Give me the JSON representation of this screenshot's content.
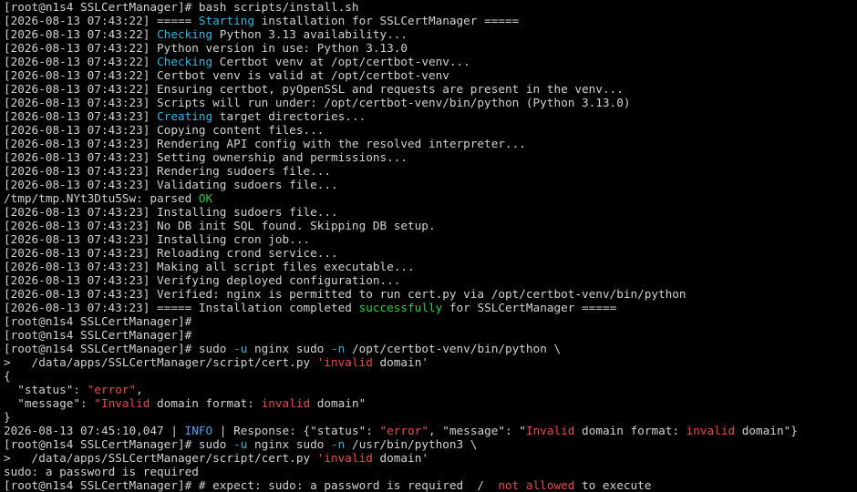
{
  "terminal": {
    "prompt": "[root@n1s4 SSLCertManager]#",
    "colors": {
      "background": "#000000",
      "default": "#d2d2d2",
      "cyan": "#29b8e6",
      "green": "#2ecc40",
      "red": "#ef4646",
      "blue": "#4aa0ee"
    },
    "lines": [
      [
        {
          "t": "[root@n1s4 SSLCertManager]# bash scripts/install.sh",
          "c": "default"
        }
      ],
      [
        {
          "t": "[2026-08-13 07:43:22] ===== ",
          "c": "default"
        },
        {
          "t": "Starting",
          "c": "cyan"
        },
        {
          "t": " installation for SSLCertManager =====",
          "c": "default"
        }
      ],
      [
        {
          "t": "[2026-08-13 07:43:22] ",
          "c": "default"
        },
        {
          "t": "Checking",
          "c": "cyan"
        },
        {
          "t": " Python 3.13 availability...",
          "c": "default"
        }
      ],
      [
        {
          "t": "[2026-08-13 07:43:22] Python version in use: Python 3.13.0",
          "c": "default"
        }
      ],
      [
        {
          "t": "[2026-08-13 07:43:22] ",
          "c": "default"
        },
        {
          "t": "Checking",
          "c": "cyan"
        },
        {
          "t": " Certbot venv at /opt/certbot-venv...",
          "c": "default"
        }
      ],
      [
        {
          "t": "[2026-08-13 07:43:22] Certbot venv is valid at /opt/certbot-venv",
          "c": "default"
        }
      ],
      [
        {
          "t": "[2026-08-13 07:43:22] Ensuring certbot, pyOpenSSL and requests are present in the venv...",
          "c": "default"
        }
      ],
      [
        {
          "t": "[2026-08-13 07:43:23] Scripts will run under: /opt/certbot-venv/bin/python (Python 3.13.0)",
          "c": "default"
        }
      ],
      [
        {
          "t": "[2026-08-13 07:43:23] ",
          "c": "default"
        },
        {
          "t": "Creating",
          "c": "cyan"
        },
        {
          "t": " target directories...",
          "c": "default"
        }
      ],
      [
        {
          "t": "[2026-08-13 07:43:23] Copying content files...",
          "c": "default"
        }
      ],
      [
        {
          "t": "[2026-08-13 07:43:23] Rendering API config with the resolved interpreter...",
          "c": "default"
        }
      ],
      [
        {
          "t": "[2026-08-13 07:43:23] Setting ownership and permissions...",
          "c": "default"
        }
      ],
      [
        {
          "t": "[2026-08-13 07:43:23] Rendering sudoers file...",
          "c": "default"
        }
      ],
      [
        {
          "t": "[2026-08-13 07:43:23] Validating sudoers file...",
          "c": "default"
        }
      ],
      [
        {
          "t": "/tmp/tmp.NYt3Dtu5Sw: parsed ",
          "c": "default"
        },
        {
          "t": "OK",
          "c": "green"
        }
      ],
      [
        {
          "t": "[2026-08-13 07:43:23] Installing sudoers file...",
          "c": "default"
        }
      ],
      [
        {
          "t": "[2026-08-13 07:43:23] No DB init SQL found. Skipping DB setup.",
          "c": "default"
        }
      ],
      [
        {
          "t": "[2026-08-13 07:43:23] Installing cron job...",
          "c": "default"
        }
      ],
      [
        {
          "t": "[2026-08-13 07:43:23] Reloading crond service...",
          "c": "default"
        }
      ],
      [
        {
          "t": "[2026-08-13 07:43:23] Making all script files executable...",
          "c": "default"
        }
      ],
      [
        {
          "t": "[2026-08-13 07:43:23] Verifying deployed configuration...",
          "c": "default"
        }
      ],
      [
        {
          "t": "[2026-08-13 07:43:23] Verified: nginx is permitted to run cert.py via /opt/certbot-venv/bin/python",
          "c": "default"
        }
      ],
      [
        {
          "t": "[2026-08-13 07:43:23] ===== Installation completed ",
          "c": "default"
        },
        {
          "t": "successfully",
          "c": "green"
        },
        {
          "t": " for SSLCertManager =====",
          "c": "default"
        }
      ],
      [
        {
          "t": "[root@n1s4 SSLCertManager]#",
          "c": "default"
        }
      ],
      [
        {
          "t": "[root@n1s4 SSLCertManager]#",
          "c": "default"
        }
      ],
      [
        {
          "t": "[root@n1s4 SSLCertManager]# sudo ",
          "c": "default"
        },
        {
          "t": "-u",
          "c": "cyan"
        },
        {
          "t": " nginx sudo ",
          "c": "default"
        },
        {
          "t": "-n",
          "c": "cyan"
        },
        {
          "t": " /opt/certbot-venv/bin/python \\",
          "c": "default"
        }
      ],
      [
        {
          "t": ">   /data/apps/SSLCertManager/script/cert.py ",
          "c": "default"
        },
        {
          "t": "'",
          "c": "red"
        },
        {
          "t": "invalid",
          "c": "red"
        },
        {
          "t": " domain'",
          "c": "default"
        }
      ],
      [
        {
          "t": "{",
          "c": "default"
        }
      ],
      [
        {
          "t": "  \"status\": ",
          "c": "default"
        },
        {
          "t": "\"error\"",
          "c": "red"
        },
        {
          "t": ",",
          "c": "default"
        }
      ],
      [
        {
          "t": "  \"message\": ",
          "c": "default"
        },
        {
          "t": "\"Invalid",
          "c": "red"
        },
        {
          "t": " domain format: ",
          "c": "default"
        },
        {
          "t": "invalid",
          "c": "red"
        },
        {
          "t": " domain\"",
          "c": "default"
        }
      ],
      [
        {
          "t": "}",
          "c": "default"
        }
      ],
      [
        {
          "t": "2026-08-13 07:45:10,047 | ",
          "c": "default"
        },
        {
          "t": "INFO",
          "c": "blue"
        },
        {
          "t": " | Response: {\"status\": ",
          "c": "default"
        },
        {
          "t": "\"error\"",
          "c": "red"
        },
        {
          "t": ", \"message\": \"",
          "c": "default"
        },
        {
          "t": "Invalid",
          "c": "red"
        },
        {
          "t": " domain format: ",
          "c": "default"
        },
        {
          "t": "invalid",
          "c": "red"
        },
        {
          "t": " domain\"}",
          "c": "default"
        }
      ],
      [
        {
          "t": "[root@n1s4 SSLCertManager]# sudo ",
          "c": "default"
        },
        {
          "t": "-u",
          "c": "cyan"
        },
        {
          "t": " nginx sudo ",
          "c": "default"
        },
        {
          "t": "-n",
          "c": "cyan"
        },
        {
          "t": " /usr/bin/python3 \\",
          "c": "default"
        }
      ],
      [
        {
          "t": ">   /data/apps/SSLCertManager/script/cert.py ",
          "c": "default"
        },
        {
          "t": "'",
          "c": "red"
        },
        {
          "t": "invalid",
          "c": "red"
        },
        {
          "t": " domain'",
          "c": "default"
        }
      ],
      [
        {
          "t": "sudo: a password is required",
          "c": "default"
        }
      ],
      [
        {
          "t": "[root@n1s4 SSLCertManager]# # expect: sudo: a password is required  /  ",
          "c": "default"
        },
        {
          "t": "not allowed",
          "c": "red"
        },
        {
          "t": " to execute",
          "c": "default"
        }
      ]
    ]
  }
}
